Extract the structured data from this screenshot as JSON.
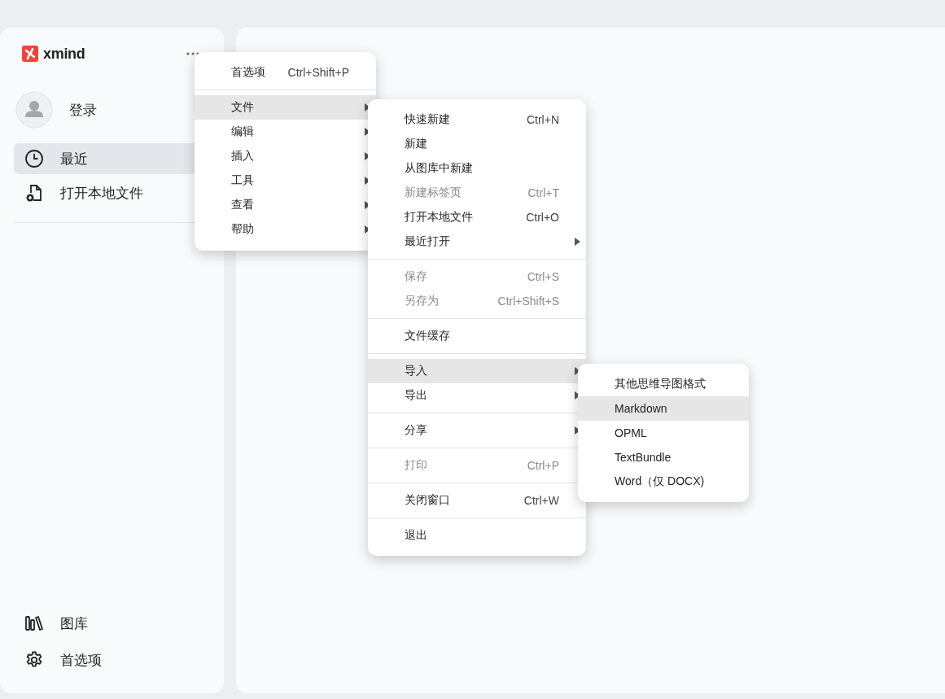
{
  "sidebar": {
    "logo_text": "xmind",
    "user": {
      "label": "登录"
    },
    "nav": [
      {
        "label": "最近",
        "selected": true
      },
      {
        "label": "打开本地文件",
        "selected": false
      }
    ],
    "bottom": [
      {
        "label": "图库"
      },
      {
        "label": "首选项"
      }
    ]
  },
  "menus": [
    {
      "items": [
        {
          "kind": "item",
          "label": "首选项",
          "shortcut": "Ctrl+Shift+P",
          "submenu": false,
          "disabled": false,
          "selected": false
        },
        {
          "kind": "separator"
        },
        {
          "kind": "item",
          "label": "文件",
          "submenu": true,
          "disabled": false,
          "selected": true
        },
        {
          "kind": "item",
          "label": "编辑",
          "submenu": true,
          "disabled": false,
          "selected": false
        },
        {
          "kind": "item",
          "label": "插入",
          "submenu": true,
          "disabled": false,
          "selected": false
        },
        {
          "kind": "item",
          "label": "工具",
          "submenu": true,
          "disabled": false,
          "selected": false
        },
        {
          "kind": "item",
          "label": "查看",
          "submenu": true,
          "disabled": false,
          "selected": false
        },
        {
          "kind": "item",
          "label": "帮助",
          "submenu": true,
          "disabled": false,
          "selected": false
        }
      ]
    },
    {
      "items": [
        {
          "kind": "item",
          "label": "快速新建",
          "shortcut": "Ctrl+N",
          "submenu": false,
          "disabled": false,
          "selected": false
        },
        {
          "kind": "item",
          "label": "新建",
          "submenu": false,
          "disabled": false,
          "selected": false
        },
        {
          "kind": "item",
          "label": "从图库中新建",
          "submenu": false,
          "disabled": false,
          "selected": false
        },
        {
          "kind": "item",
          "label": "新建标签页",
          "shortcut": "Ctrl+T",
          "submenu": false,
          "disabled": true,
          "selected": false
        },
        {
          "kind": "item",
          "label": "打开本地文件",
          "shortcut": "Ctrl+O",
          "submenu": false,
          "disabled": false,
          "selected": false
        },
        {
          "kind": "item",
          "label": "最近打开",
          "submenu": true,
          "disabled": false,
          "selected": false
        },
        {
          "kind": "separator"
        },
        {
          "kind": "item",
          "label": "保存",
          "shortcut": "Ctrl+S",
          "submenu": false,
          "disabled": true,
          "selected": false
        },
        {
          "kind": "item",
          "label": "另存为",
          "shortcut": "Ctrl+Shift+S",
          "submenu": false,
          "disabled": true,
          "selected": false
        },
        {
          "kind": "separator"
        },
        {
          "kind": "item",
          "label": "文件缓存",
          "submenu": false,
          "disabled": false,
          "selected": false
        },
        {
          "kind": "separator"
        },
        {
          "kind": "item",
          "label": "导入",
          "submenu": true,
          "disabled": false,
          "selected": true
        },
        {
          "kind": "item",
          "label": "导出",
          "submenu": true,
          "disabled": false,
          "selected": false
        },
        {
          "kind": "separator"
        },
        {
          "kind": "item",
          "label": "分享",
          "submenu": true,
          "disabled": false,
          "selected": false
        },
        {
          "kind": "separator"
        },
        {
          "kind": "item",
          "label": "打印",
          "shortcut": "Ctrl+P",
          "submenu": false,
          "disabled": true,
          "selected": false
        },
        {
          "kind": "separator"
        },
        {
          "kind": "item",
          "label": "关闭窗口",
          "shortcut": "Ctrl+W",
          "submenu": false,
          "disabled": false,
          "selected": false
        },
        {
          "kind": "separator"
        },
        {
          "kind": "item",
          "label": "退出",
          "submenu": false,
          "disabled": false,
          "selected": false
        }
      ]
    },
    {
      "items": [
        {
          "kind": "item",
          "label": "其他思维导图格式",
          "submenu": false,
          "disabled": false,
          "selected": false
        },
        {
          "kind": "item",
          "label": "Markdown",
          "submenu": false,
          "disabled": false,
          "selected": true
        },
        {
          "kind": "item",
          "label": "OPML",
          "submenu": false,
          "disabled": false,
          "selected": false
        },
        {
          "kind": "item",
          "label": "TextBundle",
          "submenu": false,
          "disabled": false,
          "selected": false
        },
        {
          "kind": "item",
          "label": "Word（仅 DOCX)",
          "submenu": false,
          "disabled": false,
          "selected": false
        }
      ]
    }
  ]
}
